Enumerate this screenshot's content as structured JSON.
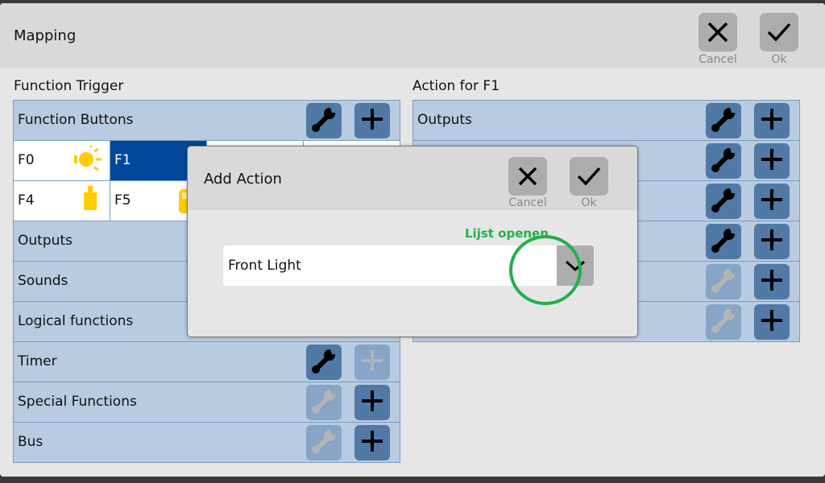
{
  "header": {
    "title": "Mapping",
    "cancel_label": "Cancel",
    "ok_label": "Ok"
  },
  "trigger": {
    "heading": "Function Trigger",
    "function_buttons": "Function Buttons",
    "cells": [
      {
        "label": "F0",
        "icon": "light-icon"
      },
      {
        "label": "F1",
        "selected": true
      },
      {
        "label": ""
      },
      {
        "label": ""
      },
      {
        "label": "F4",
        "icon": "weight-icon"
      },
      {
        "label": "F5",
        "icon": "locomotive-icon"
      }
    ],
    "rows": [
      {
        "label": "Outputs"
      },
      {
        "label": "Sounds"
      },
      {
        "label": "Logical functions"
      },
      {
        "label": "Timer",
        "wrench_enabled": true,
        "add_enabled": false
      },
      {
        "label": "Special Functions",
        "wrench_enabled": false,
        "add_enabled": true
      },
      {
        "label": "Bus",
        "wrench_enabled": false,
        "add_enabled": true
      }
    ]
  },
  "action": {
    "heading": "Action for F1",
    "rows": [
      {
        "label": "Outputs",
        "wrench_enabled": true
      },
      {
        "label": "",
        "wrench_enabled": true
      },
      {
        "label": "",
        "wrench_enabled": true
      },
      {
        "label": "",
        "wrench_enabled": true
      },
      {
        "label": "",
        "wrench_enabled": false
      },
      {
        "label": "",
        "wrench_enabled": false
      }
    ]
  },
  "dialog": {
    "title": "Add Action",
    "cancel_label": "Cancel",
    "ok_label": "Ok",
    "selected_value": "Front Light",
    "hint": "Lijst openen"
  },
  "colors": {
    "accent": "#00479a",
    "button": "#5079a6",
    "annotation": "#22b04a",
    "icon_yellow": "#ffcc00"
  }
}
